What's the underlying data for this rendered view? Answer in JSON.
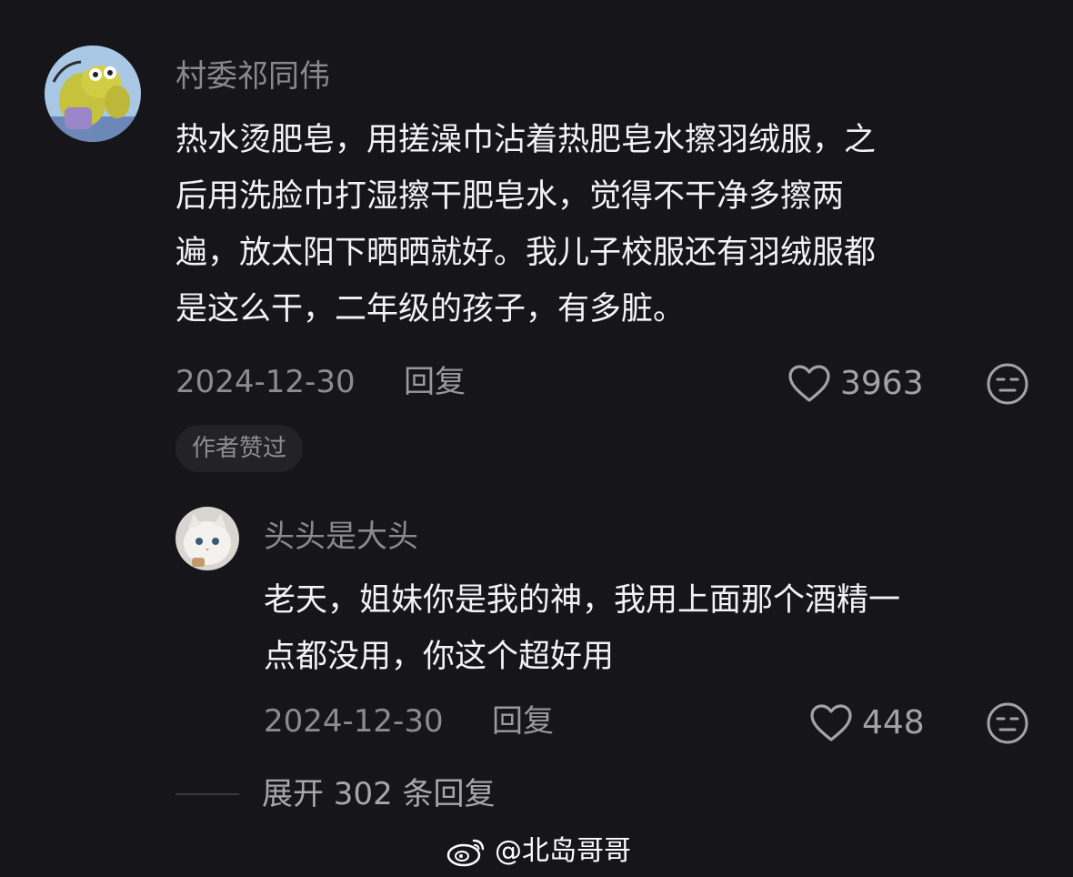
{
  "comment": {
    "username": "村委祁同伟",
    "lines": [
      "热水烫肥皂，用搓澡巾沾着热肥皂水擦羽绒服，之",
      "后用洗脸巾打湿擦干肥皂水，觉得不干净多擦两",
      "遍，放太阳下晒晒就好。我儿子校服还有羽绒服都",
      "是这么干，二年级的孩子，有多脏。"
    ],
    "date": "2024-12-30",
    "reply_label": "回复",
    "like_count": "3963",
    "author_badge": "作者赞过"
  },
  "reply": {
    "username": "头头是大头",
    "lines": [
      "老天，姐妹你是我的神，我用上面那个酒精一",
      "点都没用，你这个超好用"
    ],
    "date": "2024-12-30",
    "reply_label": "回复",
    "like_count": "448"
  },
  "expand_label": "展开 302 条回复",
  "watermark": "@北岛哥哥",
  "colors": {
    "background": "#161519",
    "text_primary": "#f3f3f5",
    "text_secondary": "#8c8b92"
  },
  "icons": [
    "heart-icon",
    "dislike-face-icon",
    "weibo-logo-icon"
  ]
}
